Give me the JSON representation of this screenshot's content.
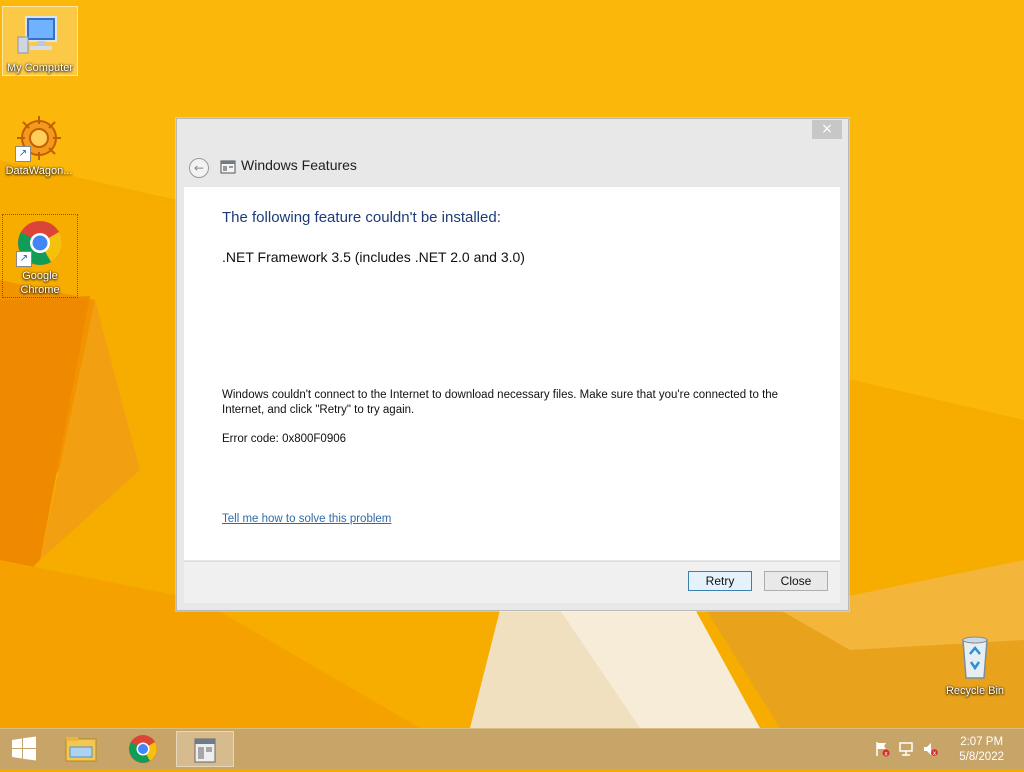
{
  "desktop": {
    "icons": [
      {
        "label": "My Computer"
      },
      {
        "label": "DataWagon..."
      },
      {
        "label": "Google Chrome"
      },
      {
        "label": "Recycle Bin"
      }
    ]
  },
  "dialog": {
    "close_glyph": "×",
    "title": "Windows Features",
    "heading": "The following feature couldn't be installed:",
    "feature": ".NET Framework 3.5 (includes .NET 2.0 and 3.0)",
    "message": "Windows couldn't connect to the Internet to download necessary files. Make sure that you're connected to the Internet, and click \"Retry\" to try again.",
    "error_code": "Error code: 0x800F0906",
    "help_link": "Tell me how to solve this problem",
    "buttons": {
      "retry": "Retry",
      "close": "Close"
    }
  },
  "taskbar": {
    "items": [
      "start-icon",
      "file-explorer-icon",
      "chrome-icon",
      "windows-features-icon"
    ],
    "tray": [
      "action-center-flag-icon",
      "network-icon",
      "volume-muted-icon"
    ],
    "time": "2:07 PM",
    "date": "5/8/2022"
  },
  "colors": {
    "desktop_bg": "#f6a800",
    "heading": "#1b3b78",
    "link": "#2e6ca8",
    "taskbar": "#c7a468"
  }
}
